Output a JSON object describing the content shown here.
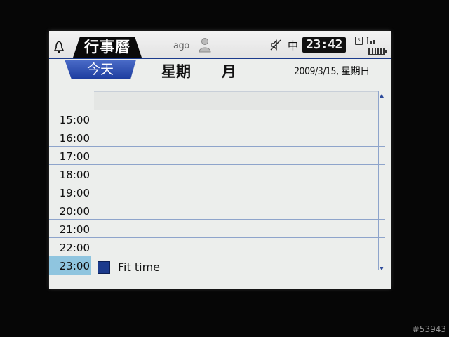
{
  "statusbar": {
    "app_title": "行事曆",
    "brand": "ago",
    "ime": "中",
    "clock": "23:42",
    "sd_label": "S"
  },
  "header": {
    "today_label": "今天",
    "week_label": "星期",
    "month_label": "月",
    "date": "2009/3/15, 星期日"
  },
  "time_slots": [
    "15:00",
    "16:00",
    "17:00",
    "18:00",
    "19:00",
    "20:00",
    "21:00",
    "22:00",
    "23:00"
  ],
  "current_slot": "23:00",
  "event": {
    "title": "Fit time",
    "color": "#1b3a8c"
  },
  "watermark": "#53943",
  "colors": {
    "accent": "#1c3c9e",
    "grid_line": "#8ea4cb",
    "current_slot": "#8fc5df"
  }
}
